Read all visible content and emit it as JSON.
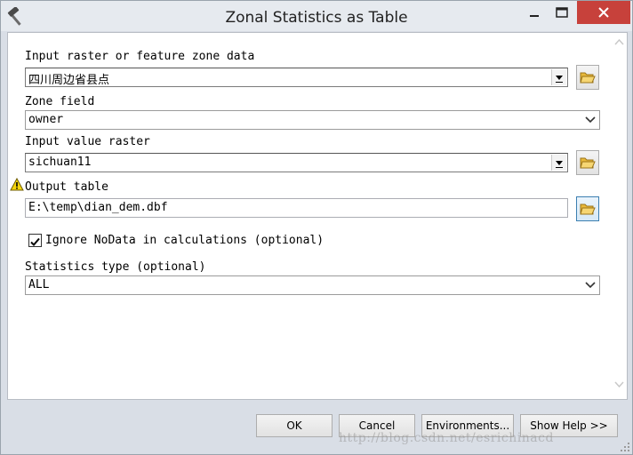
{
  "window": {
    "title": "Zonal Statistics as Table",
    "icon": "hammer-icon",
    "minimize": "minimize-icon",
    "maximize": "maximize-icon",
    "close": "close-icon"
  },
  "form": {
    "input_zone": {
      "label": "Input raster or feature zone data",
      "value": "四川周边省县点"
    },
    "zone_field": {
      "label": "Zone field",
      "value": "owner"
    },
    "input_value_raster": {
      "label": "Input value raster",
      "value": "sichuan11"
    },
    "output_table": {
      "label": "Output table",
      "value": "E:\\temp\\dian_dem.dbf",
      "warning_icon": "warning-icon"
    },
    "ignore_nodata": {
      "label": "Ignore NoData in calculations (optional)",
      "checked": true
    },
    "statistics_type": {
      "label": "Statistics type (optional)",
      "value": "ALL"
    }
  },
  "buttons": {
    "ok": "OK",
    "cancel": "Cancel",
    "environments": "Environments...",
    "show_help": "Show Help >>"
  },
  "watermark": "http://blog.csdn.net/esrichinacd",
  "colors": {
    "close_button": "#c7413b",
    "focus_border": "#3c7fb1",
    "warning": "#f5d50a"
  }
}
